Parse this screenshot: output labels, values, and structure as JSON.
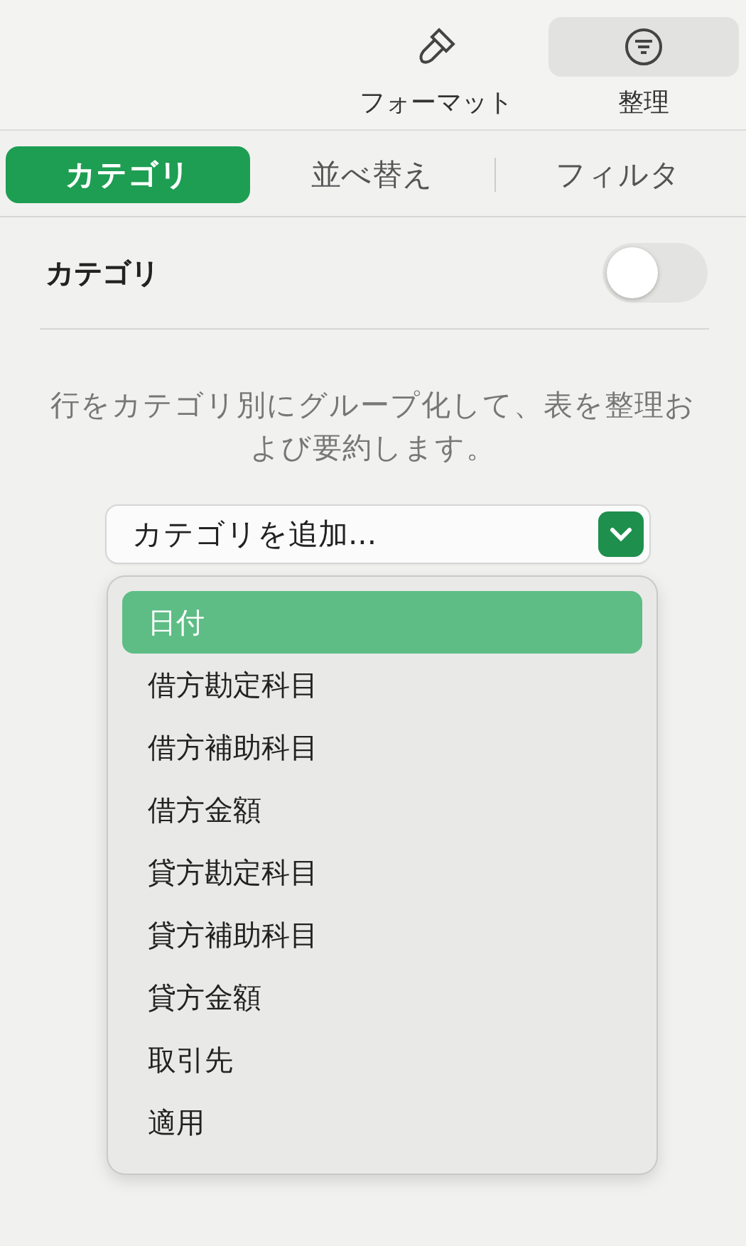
{
  "toolbar": {
    "buttons": [
      {
        "label": "フォーマット",
        "kind": "brush",
        "selected": false
      },
      {
        "label": "整理",
        "kind": "filter",
        "selected": true
      }
    ]
  },
  "tabs": [
    {
      "label": "カテゴリ",
      "selected": true
    },
    {
      "label": "並べ替え",
      "selected": false
    },
    {
      "label": "フィルタ",
      "selected": false
    }
  ],
  "category_row": {
    "label": "カテゴリ",
    "on": false
  },
  "description": "行をカテゴリ別にグループ化して、表を整理および要約します。",
  "add_category": {
    "label": "カテゴリを追加...",
    "expanded": true
  },
  "menu": {
    "items": [
      {
        "label": "日付",
        "selected": true
      },
      {
        "label": "借方勘定科目",
        "selected": false
      },
      {
        "label": "借方補助科目",
        "selected": false
      },
      {
        "label": "借方金額",
        "selected": false
      },
      {
        "label": "貸方勘定科目",
        "selected": false
      },
      {
        "label": "貸方補助科目",
        "selected": false
      },
      {
        "label": "貸方金額",
        "selected": false
      },
      {
        "label": "取引先",
        "selected": false
      },
      {
        "label": "適用",
        "selected": false
      }
    ]
  }
}
